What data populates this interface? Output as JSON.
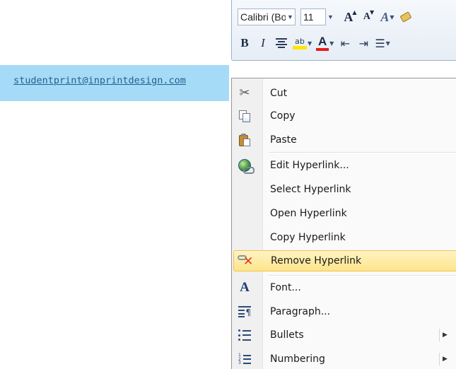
{
  "toolbar": {
    "font_name": "Calibri (Boc",
    "font_size": "11",
    "grow_font_glyph": "A",
    "shrink_font_glyph": "A",
    "styles_glyph": "A",
    "bold_glyph": "B",
    "italic_glyph": "I",
    "highlight_glyph": "ab",
    "font_color_glyph": "A",
    "highlight_color": "#ffe500",
    "font_color": "#e81a1a"
  },
  "document": {
    "hyperlink_text": "studentprint@inprintdesign.com",
    "hyperlink_selection_color": "#a6dbf7"
  },
  "context_menu": {
    "cut": "Cut",
    "copy": "Copy",
    "paste": "Paste",
    "edit_hyperlink": "Edit Hyperlink...",
    "select_hyperlink": "Select Hyperlink",
    "open_hyperlink": "Open Hyperlink",
    "copy_hyperlink": "Copy Hyperlink",
    "remove_hyperlink": "Remove Hyperlink",
    "font": "Font...",
    "paragraph": "Paragraph...",
    "bullets": "Bullets",
    "numbering": "Numbering",
    "highlighted_item": "Remove Hyperlink",
    "highlight_color": "#fde58a"
  }
}
